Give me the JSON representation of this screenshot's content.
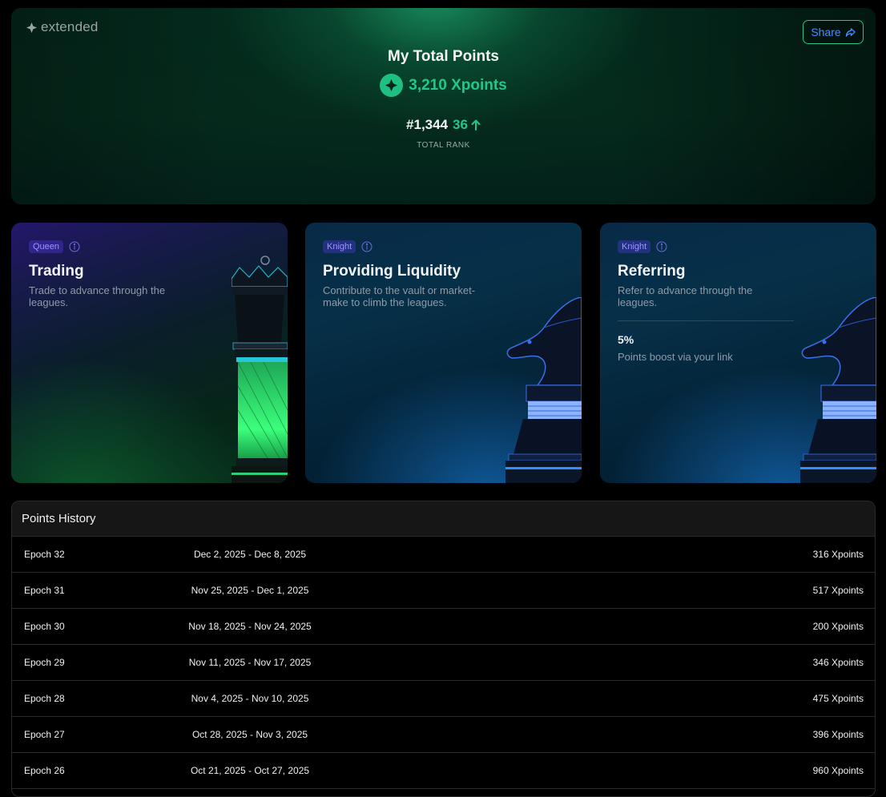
{
  "brand": {
    "logo_text": "extended"
  },
  "hero": {
    "share_label": "Share",
    "title": "My Total Points",
    "points": "3,210 Xpoints",
    "rank": "#1,344",
    "rank_change": "36",
    "rank_label": "TOTAL RANK"
  },
  "leagues": [
    {
      "tag": "Queen",
      "title": "Trading",
      "description": "Trade to advance through the leagues."
    },
    {
      "tag": "Knight",
      "title": "Providing Liquidity",
      "description": "Contribute to the vault or market-make to climb the leagues."
    },
    {
      "tag": "Knight",
      "title": "Referring",
      "description": "Refer to advance through the leagues.",
      "boost_value": "5%",
      "boost_label": "Points boost via your link"
    }
  ],
  "history": {
    "title": "Points History",
    "rows": [
      {
        "epoch": "Epoch 32",
        "range": "Dec 2, 2025 - Dec 8, 2025",
        "points": "316 Xpoints"
      },
      {
        "epoch": "Epoch 31",
        "range": "Nov 25, 2025 - Dec 1, 2025",
        "points": "517 Xpoints"
      },
      {
        "epoch": "Epoch 30",
        "range": "Nov 18, 2025 - Nov 24, 2025",
        "points": "200 Xpoints"
      },
      {
        "epoch": "Epoch 29",
        "range": "Nov 11, 2025 - Nov 17, 2025",
        "points": "346 Xpoints"
      },
      {
        "epoch": "Epoch 28",
        "range": "Nov 4, 2025 - Nov 10, 2025",
        "points": "475 Xpoints"
      },
      {
        "epoch": "Epoch 27",
        "range": "Oct 28, 2025 - Nov 3, 2025",
        "points": "396 Xpoints"
      },
      {
        "epoch": "Epoch 26",
        "range": "Oct 21, 2025 - Oct 27, 2025",
        "points": "960 Xpoints"
      }
    ]
  },
  "colors": {
    "accent_green": "#20c889",
    "share_border": "#22c58a",
    "share_text": "#4a8dff",
    "tag_bg": "#3a2fa0",
    "tag_text": "#9d92ff"
  },
  "icons": {
    "logo": "extended-logo-icon",
    "share": "share-arrow-icon",
    "points": "xpoints-icon",
    "rank_up": "arrow-up-icon",
    "info": "info-icon",
    "queen": "queen-chess-piece",
    "knight": "knight-chess-piece"
  }
}
